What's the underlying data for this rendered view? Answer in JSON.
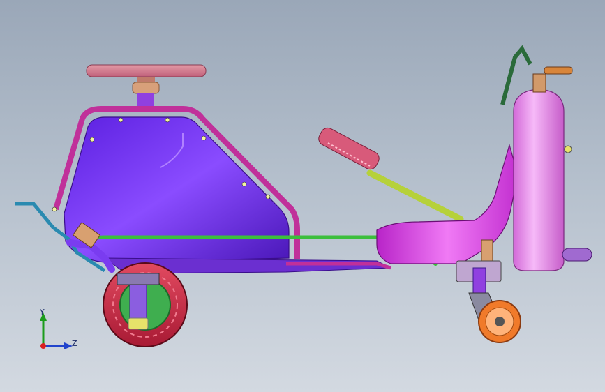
{
  "viewport": {
    "background_top": "#9aa7b8",
    "background_bottom": "#d3d9e1"
  },
  "model": {
    "parts": [
      {
        "name": "steering-wheel",
        "color": "#e08a98"
      },
      {
        "name": "fuel-tank-body",
        "color": "#7a3cf0"
      },
      {
        "name": "frame-tube",
        "color": "#c0309a"
      },
      {
        "name": "side-rail",
        "color": "#3cbf3c"
      },
      {
        "name": "rear-wheel",
        "color": "#d9304a"
      },
      {
        "name": "hub",
        "color": "#3fae4f"
      },
      {
        "name": "handle-bar",
        "color": "#b6d13a"
      },
      {
        "name": "grip",
        "color": "#d85a7a"
      },
      {
        "name": "seat-body",
        "color": "#d93ce0"
      },
      {
        "name": "extinguisher-cylinder",
        "color": "#e58aeb"
      },
      {
        "name": "caster-wheel",
        "color": "#f07a2a"
      }
    ]
  },
  "triad": {
    "y_label": "Y",
    "z_label": "Z",
    "x_color": "#d92020",
    "y_color": "#1c9c1c",
    "z_color": "#2244cc"
  }
}
